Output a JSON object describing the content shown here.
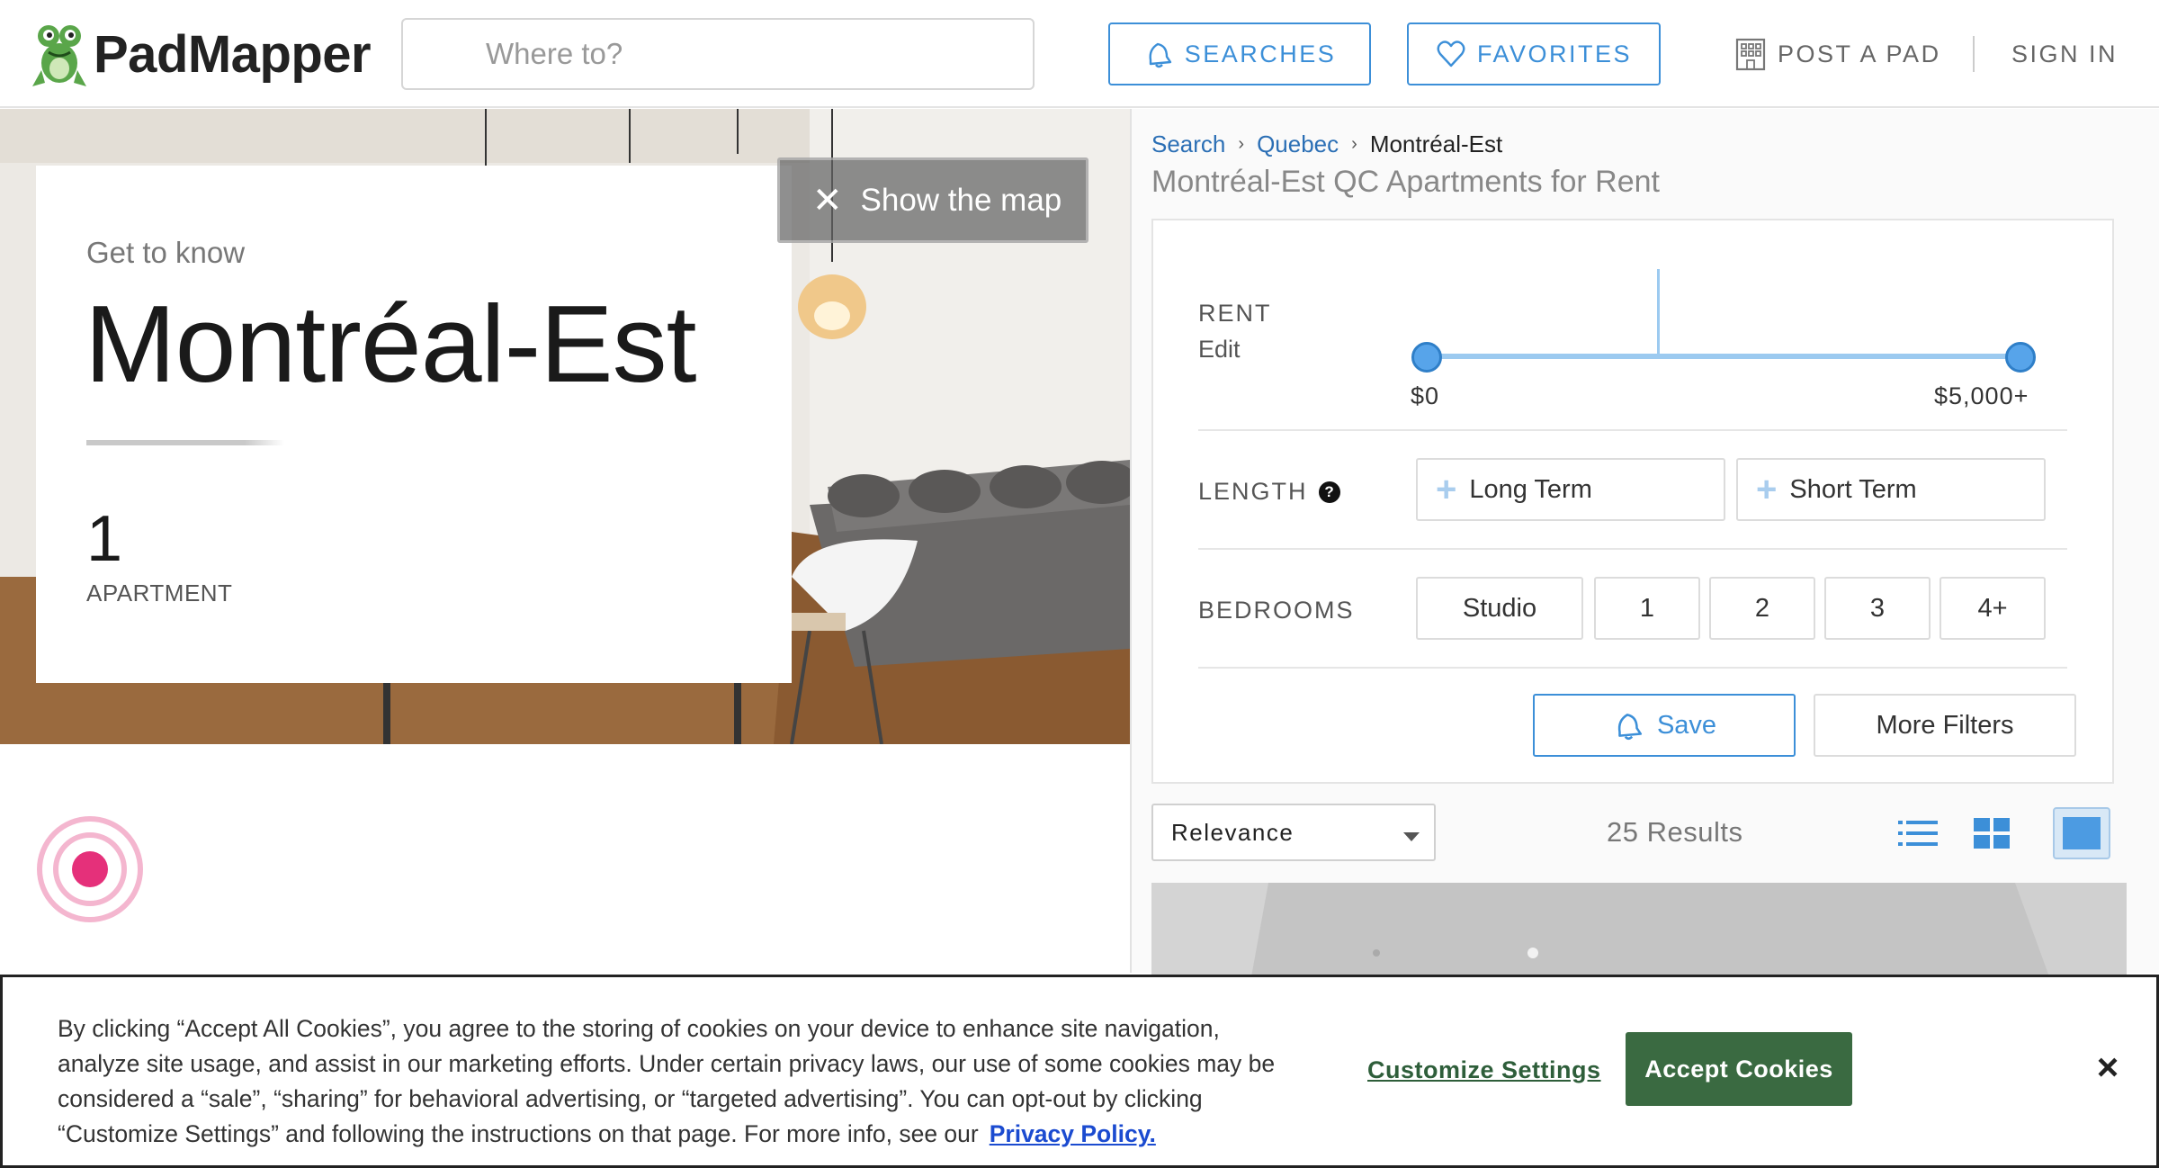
{
  "header": {
    "logo_text": "PadMapper",
    "search_placeholder": "Where to?",
    "searches_label": "SEARCHES",
    "favorites_label": "FAVORITES",
    "post_pad_label": "POST A PAD",
    "sign_in_label": "SIGN IN",
    "accent_color": "#3c8fd8"
  },
  "hero": {
    "get_to_know": "Get to know",
    "neighborhood": "Montréal-Est",
    "count": "1",
    "count_label": "APARTMENT",
    "show_map_label": "Show the map"
  },
  "breadcrumb": {
    "items": [
      "Search",
      "Quebec",
      "Montréal-Est"
    ]
  },
  "page_title": "Montréal-Est QC Apartments for Rent",
  "filters": {
    "rent_label": "RENT",
    "rent_edit": "Edit",
    "rent_min": "$0",
    "rent_max": "$5,000+",
    "length_label": "LENGTH",
    "length_help_icon": "?",
    "length_options": [
      "Long Term",
      "Short Term"
    ],
    "bedrooms_label": "BEDROOMS",
    "bedroom_options": [
      "Studio",
      "1",
      "2",
      "3",
      "4+"
    ],
    "save_label": "Save",
    "more_filters_label": "More Filters"
  },
  "results_bar": {
    "sort_selected": "Relevance",
    "results_count": "25 Results",
    "view_icons": [
      "list-view-icon",
      "grid-view-icon",
      "map-view-icon"
    ],
    "active_view": "map-view-icon"
  },
  "cookie_banner": {
    "text": "By clicking “Accept All Cookies”, you agree to the storing of cookies on your device to enhance site navigation, analyze site usage, and assist in our marketing efforts. Under certain privacy laws, our use of some cookies may be considered a “sale”, “sharing” for behavioral advertising, or “targeted advertising”. You can opt-out by clicking “Customize Settings” and following the instructions on that page. For more info, see our",
    "privacy_link": "Privacy Policy.",
    "customize_label": "Customize Settings",
    "accept_label": "Accept Cookies",
    "close_icon": "×",
    "accept_color": "#3a6a41"
  }
}
